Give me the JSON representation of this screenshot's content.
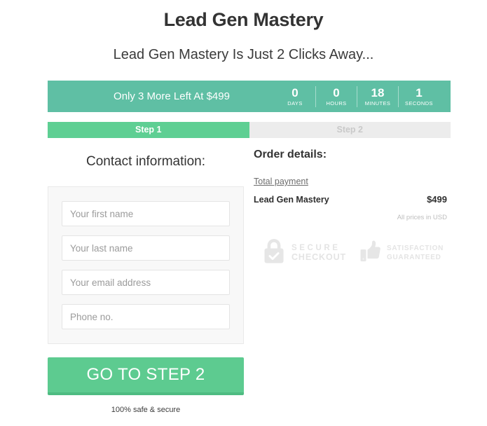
{
  "header": {
    "title": "Lead Gen Mastery",
    "subtitle": "Lead Gen Mastery Is Just 2 Clicks Away..."
  },
  "banner": {
    "text": "Only 3 More Left At $499",
    "background_color": "#5fbfa4",
    "timer": [
      {
        "value": "0",
        "label": "DAYS"
      },
      {
        "value": "0",
        "label": "HOURS"
      },
      {
        "value": "18",
        "label": "MINUTES"
      },
      {
        "value": "1",
        "label": "SECONDS"
      }
    ]
  },
  "steps": [
    {
      "label": "Step 1",
      "state": "active",
      "color": "#5ecf93"
    },
    {
      "label": "Step 2",
      "state": "inactive",
      "color": "#ececec"
    }
  ],
  "contact": {
    "heading": "Contact information:",
    "fields": [
      {
        "name": "first-name",
        "placeholder": "Your first name",
        "value": ""
      },
      {
        "name": "last-name",
        "placeholder": "Your last name",
        "value": ""
      },
      {
        "name": "email",
        "placeholder": "Your email address",
        "value": ""
      },
      {
        "name": "phone",
        "placeholder": "Phone no.",
        "value": ""
      }
    ],
    "cta_label": "GO TO STEP 2",
    "cta_color": "#5dcb90",
    "safe_note": "100% safe & secure"
  },
  "order": {
    "heading": "Order details:",
    "total_payment_label": "Total payment",
    "line_item": {
      "name": "Lead Gen Mastery",
      "price": "$499"
    },
    "currency_note": "All prices in USD"
  },
  "badges": [
    {
      "icon": "lock-icon",
      "line1": "SECURE",
      "line2": "CHECKOUT"
    },
    {
      "icon": "thumbs-up-icon",
      "line1": "SATISFACTION",
      "line2": "GUARANTEED"
    }
  ]
}
